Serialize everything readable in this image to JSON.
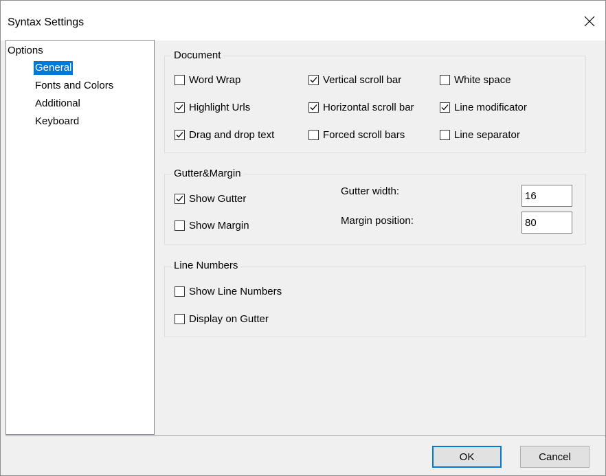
{
  "window": {
    "title": "Syntax Settings"
  },
  "tree": {
    "root_label": "Options",
    "items": [
      {
        "label": "General",
        "selected": true
      },
      {
        "label": "Fonts and Colors",
        "selected": false
      },
      {
        "label": "Additional",
        "selected": false
      },
      {
        "label": "Keyboard",
        "selected": false
      }
    ]
  },
  "document_group": {
    "title": "Document",
    "checkboxes": [
      {
        "label": "Word Wrap",
        "checked": false
      },
      {
        "label": "Vertical scroll bar",
        "checked": true
      },
      {
        "label": "White space",
        "checked": false
      },
      {
        "label": "Highlight Urls",
        "checked": true
      },
      {
        "label": "Horizontal scroll bar",
        "checked": true
      },
      {
        "label": "Line modificator",
        "checked": true
      },
      {
        "label": "Drag and drop text",
        "checked": true
      },
      {
        "label": "Forced scroll bars",
        "checked": false
      },
      {
        "label": "Line separator",
        "checked": false
      }
    ]
  },
  "gutter_group": {
    "title": "Gutter&Margin",
    "show_gutter": {
      "label": "Show Gutter",
      "checked": true
    },
    "show_margin": {
      "label": "Show Margin",
      "checked": false
    },
    "gutter_width": {
      "label": "Gutter width:",
      "value": "16"
    },
    "margin_position": {
      "label": "Margin position:",
      "value": "80"
    }
  },
  "line_numbers_group": {
    "title": "Line Numbers",
    "show_line_numbers": {
      "label": "Show Line Numbers",
      "checked": false
    },
    "display_on_gutter": {
      "label": "Display on Gutter",
      "checked": false
    }
  },
  "buttons": {
    "ok": "OK",
    "cancel": "Cancel"
  },
  "colors": {
    "selection": "#0078d7",
    "dialog_bg": "#f0f0f0"
  }
}
